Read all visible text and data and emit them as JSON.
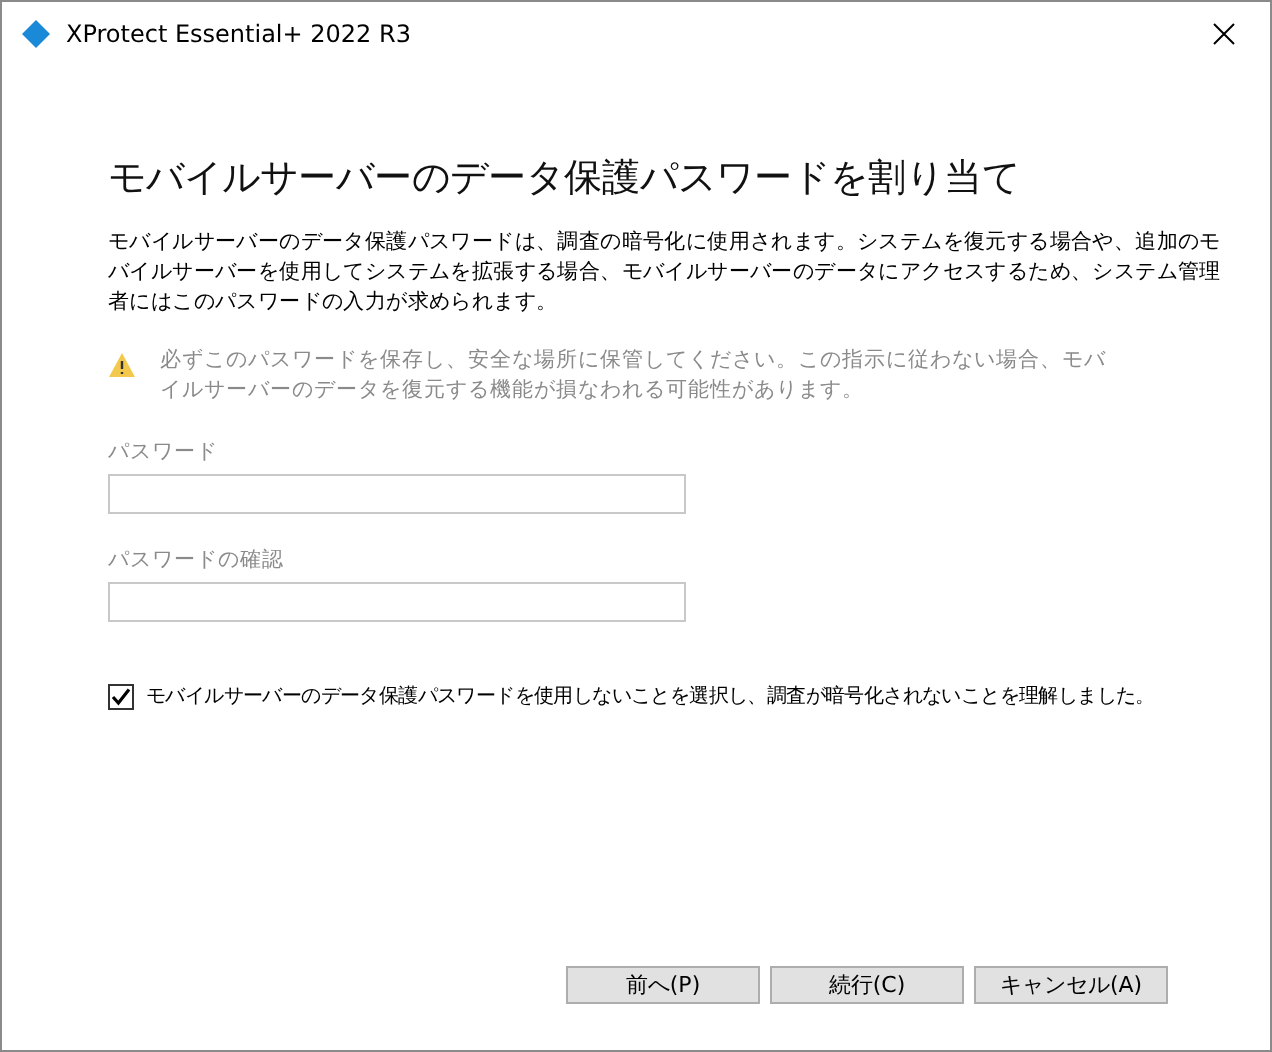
{
  "window": {
    "title": "XProtect Essential+ 2022 R3"
  },
  "heading": "モバイルサーバーのデータ保護パスワードを割り当て",
  "description": "モバイルサーバーのデータ保護パスワードは、調査の暗号化に使用されます。システムを復元する場合や、追加のモバイルサーバーを使用してシステムを拡張する場合、モバイルサーバーのデータにアクセスするため、システム管理者にはこのパスワードの入力が求められます。",
  "warning": "必ずこのパスワードを保存し、安全な場所に保管してください。この指示に従わない場合、モバイルサーバーのデータを復元する機能が損なわれる可能性があります。",
  "fields": [
    {
      "label": "パスワード",
      "disabled": true
    },
    {
      "label": "パスワードの確認",
      "disabled": true
    }
  ],
  "checkbox": {
    "label": "モバイルサーバーのデータ保護パスワードを使用しないことを選択し、調査が暗号化されないことを理解しました。",
    "checked": true
  },
  "buttons": [
    "前へ(P)",
    "続行(C)",
    "キャンセル(A)"
  ]
}
